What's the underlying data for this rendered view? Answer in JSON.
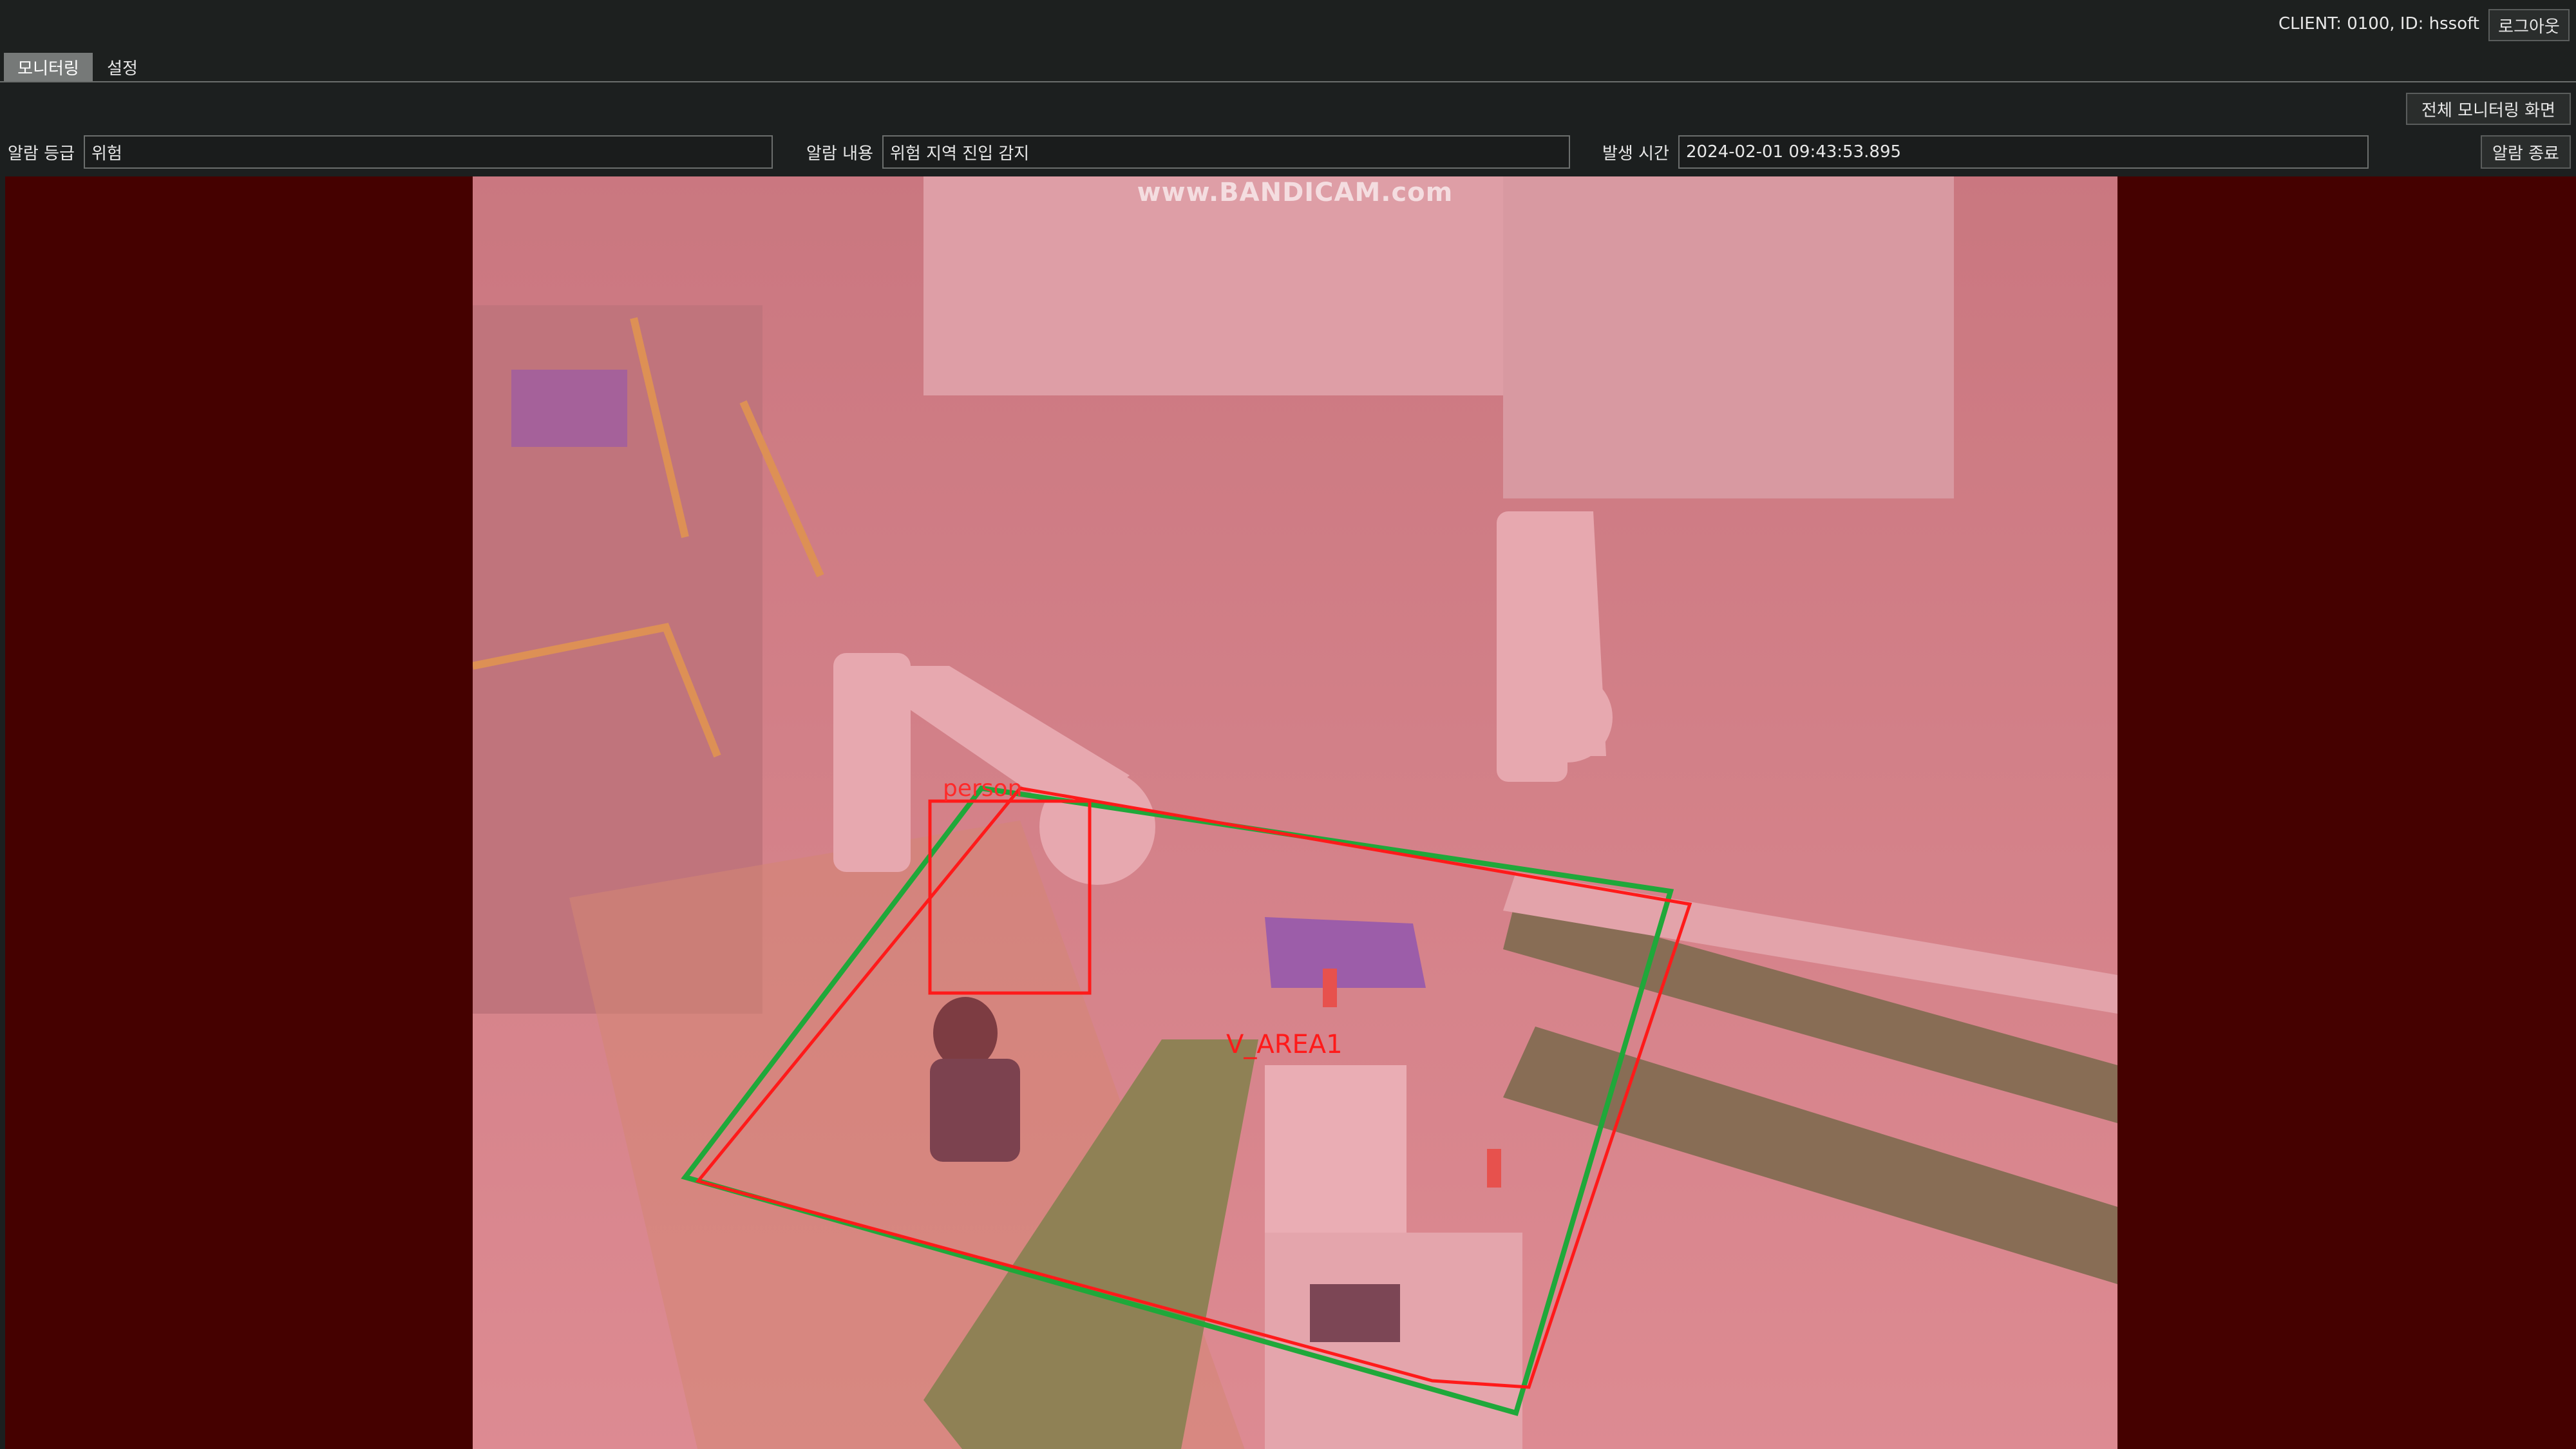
{
  "header": {
    "client_info": "CLIENT: 0100, ID: hssoft",
    "logout_label": "로그아웃"
  },
  "tabs": [
    {
      "label": "모니터링",
      "active": true
    },
    {
      "label": "설정",
      "active": false
    }
  ],
  "toolbar": {
    "full_monitoring_label": "전체 모니터링 화면",
    "alarm_end_label": "알람 종료"
  },
  "alarm": {
    "level_label": "알람 등급",
    "level_value": "위험",
    "content_label": "알람 내용",
    "content_value": "위험 지역 진입 감지",
    "time_label": "발생 시간",
    "time_value": "2024-02-01 09:43:53.895"
  },
  "video": {
    "watermark": "www.BANDICAM.com",
    "zone_label": "V_AREA1",
    "person_label": "person",
    "overlay_color": "#e85a6a",
    "zone_colors": {
      "outer": "#1fa83a",
      "inner": "#ff1a1a"
    },
    "panel_background": "#450100"
  }
}
